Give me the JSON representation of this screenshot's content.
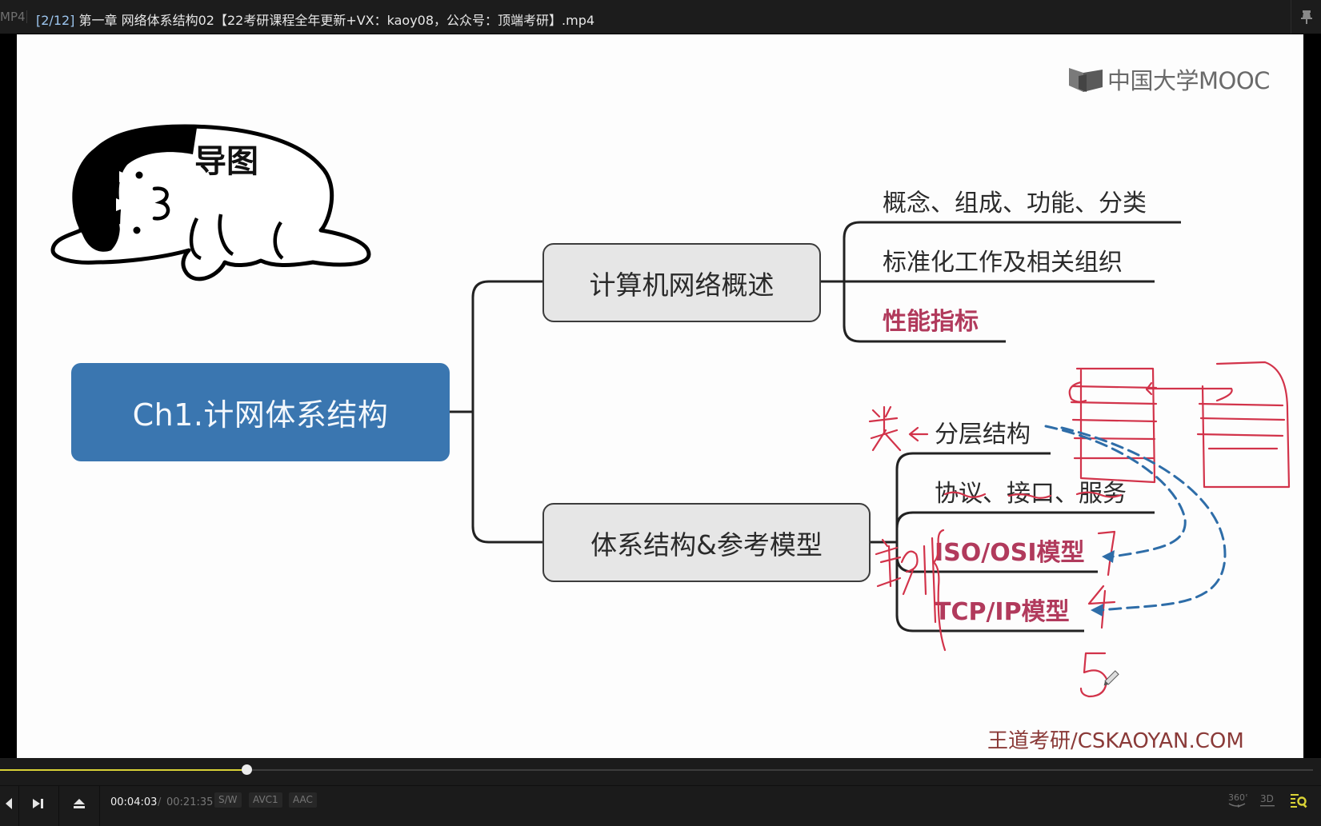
{
  "titlebar": {
    "format": "MP4",
    "index": "[2/12]",
    "title": " 第一章 网络体系结构02【22考研课程全年更新+VX：kaoy08，公众号：顶端考研】.mp4",
    "pin_icon": "pin-icon"
  },
  "video": {
    "logo_text": "中国大学MOOC",
    "mascot_label": "导图",
    "root_node": "Ch1.计网体系结构",
    "branches": [
      {
        "label": "计算机网络概述",
        "children": [
          {
            "label": "概念、组成、功能、分类",
            "highlight": false
          },
          {
            "label": "标准化工作及相关组织",
            "highlight": false
          },
          {
            "label": "性能指标",
            "highlight": true
          }
        ]
      },
      {
        "label": "体系结构&参考模型",
        "children": [
          {
            "label": "分层结构",
            "highlight": false
          },
          {
            "label": "协议、接口、服务",
            "highlight": false
          },
          {
            "label": "ISO/OSI模型",
            "highlight": true
          },
          {
            "label": "TCP/IP模型",
            "highlight": true
          }
        ]
      }
    ],
    "handwriting": {
      "near_layer": "类",
      "near_models": "实例",
      "osi_layers": "7",
      "tcpip_layers": "4",
      "extra": "5"
    },
    "watermark": "王道考研/CSKAOYAN.COM",
    "colors": {
      "root_fill": "#3a76b0",
      "highlight_text": "#b13a5c",
      "pen_red": "#d2334a",
      "dashed_arrow": "#2e6da8"
    }
  },
  "player": {
    "progress_fraction": 0.1877,
    "current_time": "00:04:03",
    "separator": "/",
    "total_time": "00:21:35",
    "badges": [
      "S/W",
      "AVC1",
      "AAC"
    ],
    "buttons": [
      "prev",
      "next",
      "eject"
    ],
    "right_icons": [
      "360°",
      "3D",
      "playlist-search"
    ],
    "label_360": "360°",
    "label_3d": "3D",
    "accent": "#d9d236"
  }
}
